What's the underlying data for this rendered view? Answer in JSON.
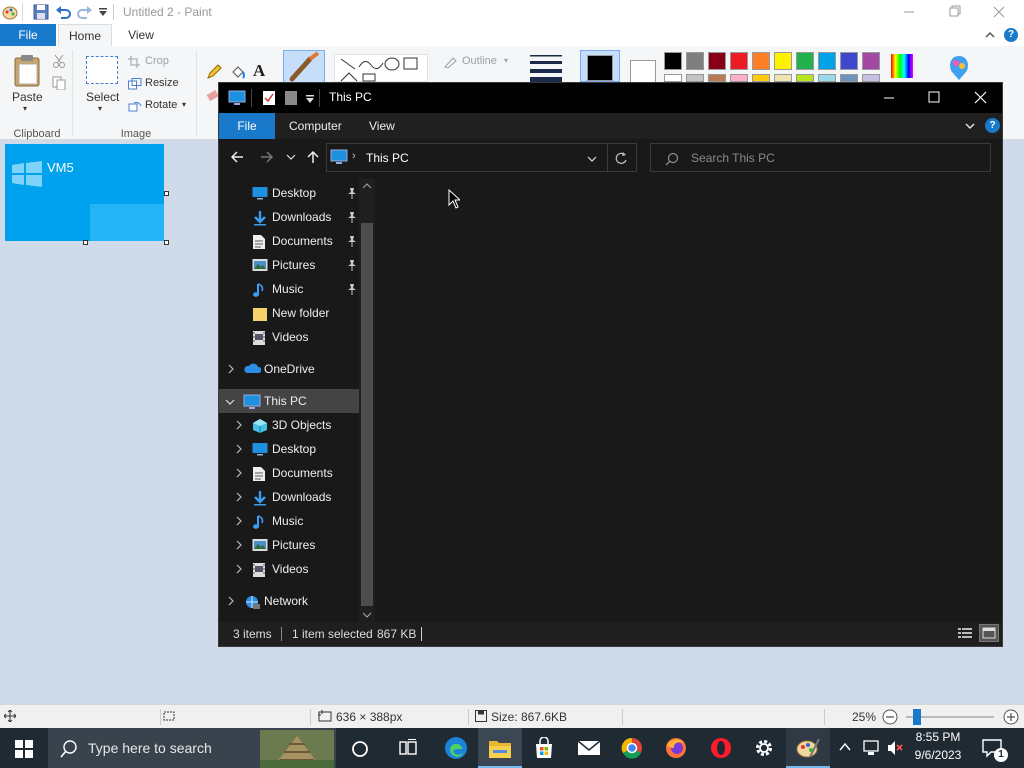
{
  "paint": {
    "title": "Untitled 2 - Paint",
    "tabs": {
      "file": "File",
      "home": "Home",
      "view": "View"
    },
    "clipboard": {
      "paste": "Paste",
      "group": "Clipboard"
    },
    "image": {
      "select": "Select",
      "crop": "Crop",
      "resize": "Resize",
      "rotate": "Rotate",
      "group": "Image"
    },
    "shapes": {
      "outline": "Outline"
    },
    "palette": [
      "#000000",
      "#7f7f7f",
      "#880015",
      "#ed1c24",
      "#ff7f27",
      "#fff200",
      "#22b14c",
      "#00a2e8",
      "#3f48cc",
      "#a349a4"
    ],
    "palette2": [
      "#ffffff",
      "#c3c3c3",
      "#b97a57",
      "#ffaec9",
      "#ffc90e",
      "#efe4b0",
      "#b5e61d",
      "#99d9ea",
      "#7092be",
      "#c8bfe7"
    ],
    "colors": {
      "color1": "#000000",
      "color2": "#ffffff",
      "canvas": "#cfdbe9",
      "selection": "#00a2ed"
    },
    "canvas_label": "VM5",
    "status": {
      "selection_size": "636 × 388px",
      "file_size": "Size: 867.6KB",
      "zoom": "25%"
    }
  },
  "explorer": {
    "title": "This PC",
    "menu": {
      "file": "File",
      "computer": "Computer",
      "view": "View"
    },
    "address": {
      "crumb": "This PC",
      "search_placeholder": "Search This PC"
    },
    "quick_access": [
      {
        "label": "Desktop",
        "icon": "desktop-icon",
        "pinned": true
      },
      {
        "label": "Downloads",
        "icon": "downloads-icon",
        "pinned": true
      },
      {
        "label": "Documents",
        "icon": "documents-icon",
        "pinned": true
      },
      {
        "label": "Pictures",
        "icon": "pictures-icon",
        "pinned": true
      },
      {
        "label": "Music",
        "icon": "music-icon",
        "pinned": true
      },
      {
        "label": "New folder",
        "icon": "folder-icon",
        "pinned": false
      },
      {
        "label": "Videos",
        "icon": "videos-icon",
        "pinned": false
      }
    ],
    "onedrive": "OneDrive",
    "this_pc": "This PC",
    "this_pc_children": [
      {
        "label": "3D Objects",
        "icon": "3d-objects-icon"
      },
      {
        "label": "Desktop",
        "icon": "desktop-icon"
      },
      {
        "label": "Documents",
        "icon": "documents-icon"
      },
      {
        "label": "Downloads",
        "icon": "downloads-icon"
      },
      {
        "label": "Music",
        "icon": "music-icon"
      },
      {
        "label": "Pictures",
        "icon": "pictures-icon"
      },
      {
        "label": "Videos",
        "icon": "videos-icon"
      }
    ],
    "network": "Network",
    "status": {
      "items": "3 items",
      "selected": "1 item selected",
      "size": "867 KB"
    }
  },
  "taskbar": {
    "search_placeholder": "Type here to search",
    "time": "8:55 PM",
    "date": "9/6/2023",
    "notification_count": "1",
    "apps": [
      "task-view-icon",
      "edge-icon",
      "file-explorer-icon",
      "store-icon",
      "mail-icon",
      "chrome-icon",
      "firefox-icon",
      "opera-icon",
      "settings-icon",
      "paint-icon"
    ]
  }
}
